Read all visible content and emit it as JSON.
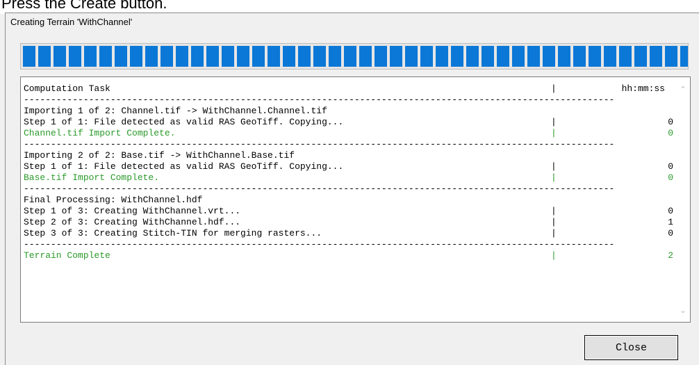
{
  "top_strip": {
    "text": "Press the Create button."
  },
  "window": {
    "title": "Creating Terrain 'WithChannel'"
  },
  "progress": {
    "percent": 100,
    "segment_color": "#0b78d7"
  },
  "log": {
    "header": {
      "task": "Computation Task",
      "bar": "|",
      "time": "hh:mm:ss"
    },
    "separator": "-------------------------------------------------------------------------------------------------------------",
    "groups": [
      {
        "lines": [
          {
            "text": "Importing 1 of 2: Channel.tif -> WithChannel.Channel.tif",
            "bar": "",
            "time": "",
            "green": false
          },
          {
            "text": "Step 1 of 1: File detected as valid RAS GeoTiff. Copying...",
            "bar": "|",
            "time": "0",
            "green": false
          },
          {
            "text": "Channel.tif Import Complete.",
            "bar": "|",
            "time": "0",
            "green": true
          }
        ]
      },
      {
        "lines": [
          {
            "text": "Importing 2 of 2: Base.tif -> WithChannel.Base.tif",
            "bar": "",
            "time": "",
            "green": false
          },
          {
            "text": "Step 1 of 1: File detected as valid RAS GeoTiff. Copying...",
            "bar": "|",
            "time": "0",
            "green": false
          },
          {
            "text": "Base.tif Import Complete.",
            "bar": "|",
            "time": "0",
            "green": true
          }
        ]
      },
      {
        "lines": [
          {
            "text": "Final Processing: WithChannel.hdf",
            "bar": "",
            "time": "",
            "green": false
          },
          {
            "text": "Step 1 of 3: Creating WithChannel.vrt...",
            "bar": "|",
            "time": "0",
            "green": false
          },
          {
            "text": "Step 2 of 3: Creating WithChannel.hdf...",
            "bar": "|",
            "time": "1",
            "green": false
          },
          {
            "text": "Step 3 of 3: Creating Stitch-TIN for merging rasters...",
            "bar": "|",
            "time": "0",
            "green": false
          }
        ]
      },
      {
        "lines": [
          {
            "text": "Terrain Complete",
            "bar": "|",
            "time": "2",
            "green": true
          }
        ]
      }
    ]
  },
  "scrollbar": {
    "up_icon": "chevron-up-icon",
    "down_icon": "chevron-down-icon"
  },
  "buttons": {
    "close_label": "Close"
  }
}
